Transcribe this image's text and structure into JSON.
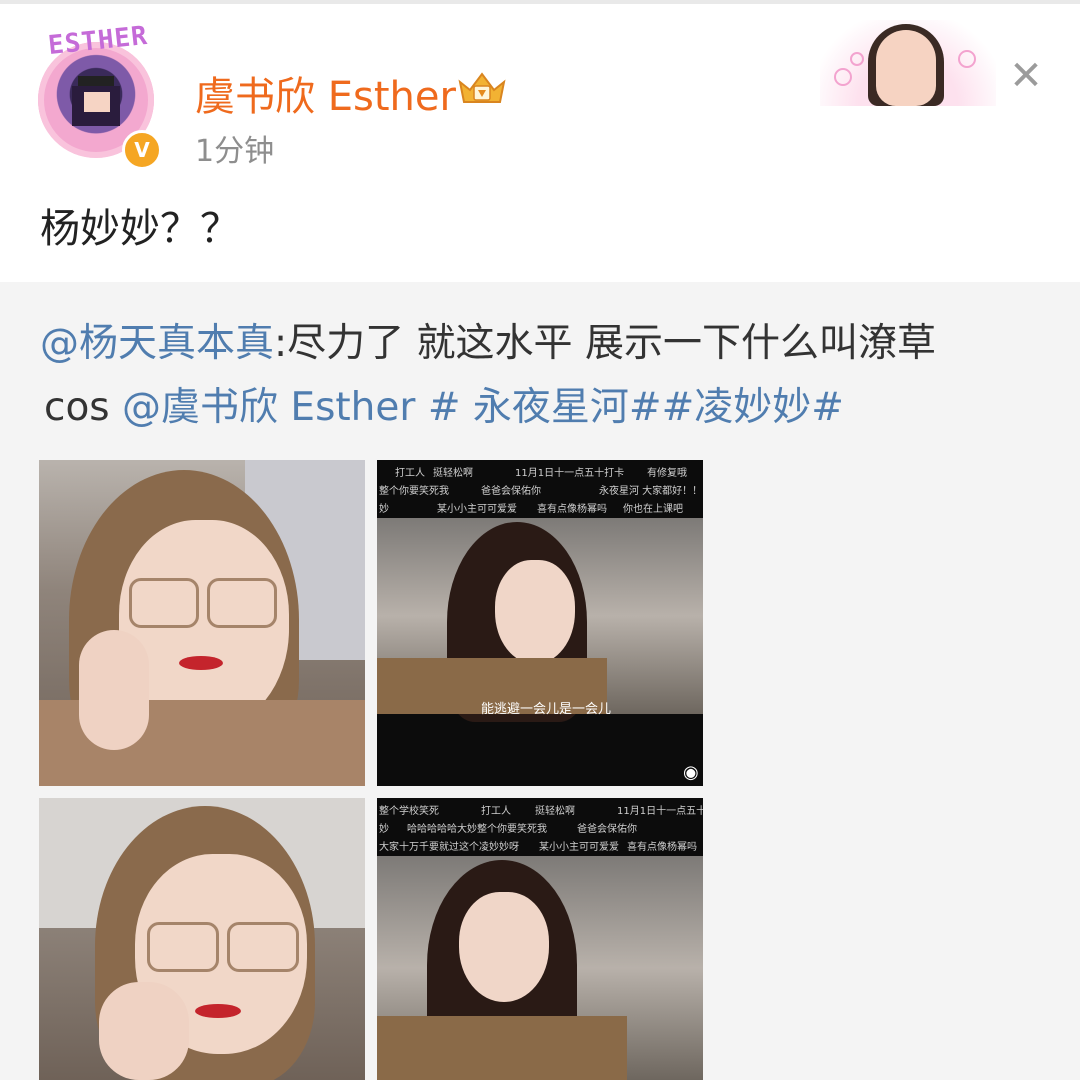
{
  "post": {
    "username": "虞书欣 Esther",
    "timestamp": "1分钟",
    "text": "杨妙妙？？",
    "avatar_label": "ESTHER",
    "verified_mark": "V"
  },
  "icons": {
    "close": "close-icon",
    "crown": "crown-badge-icon",
    "verified": "verified-badge-icon",
    "weibo": "weibo-logo-icon"
  },
  "repost": {
    "line1_mention": "@杨天真本真",
    "line1_text": ":尽力了 就这水平 展示一下什么叫潦草",
    "line2_prefix": "cos ",
    "line2_mention": "@虞书欣 Esther",
    "line2_tags": " # 永夜星河##凌妙妙#"
  },
  "images": {
    "top_right": {
      "danmu": [
        "打工人",
        "挺轻松啊",
        "11月1日十一点五十打卡",
        "有修复哦",
        "整个你要笑死我",
        "爸爸会保佑你",
        "永夜星河 大家都好！！！！",
        "妙",
        "某小小主可可爱爱",
        "喜有点像杨幂吗",
        "你也在上课吧"
      ],
      "subtitle": "能逃避一会儿是一会儿",
      "logo": "weibo"
    },
    "bottom_right": {
      "danmu": [
        "整个学校笑死",
        "打工人",
        "挺轻松啊",
        "11月1日十一点五十打卡",
        "妙",
        "哈哈哈哈哈大妙整个你要笑死我",
        "爸爸会保佑你",
        "大家十万千要就过这个凌妙妙呀",
        "某小小主可可爱爱",
        "喜有点像杨幂吗"
      ]
    }
  },
  "colors": {
    "username": "#ef6a1d",
    "link": "#507daf",
    "text": "#222222",
    "timestamp": "#8e8e8e",
    "repost_bg": "#f4f4f4"
  }
}
